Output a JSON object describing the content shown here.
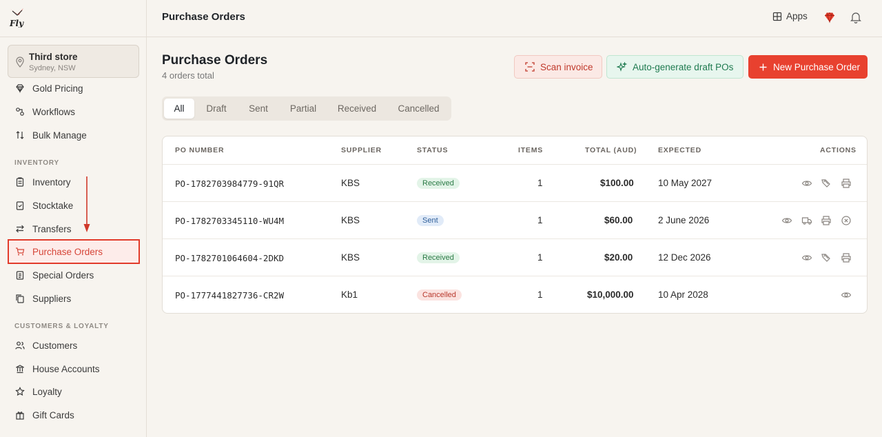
{
  "app": {
    "logo_text": "Fly"
  },
  "store": {
    "name": "Third store",
    "location": "Sydney, NSW"
  },
  "sidebar": {
    "items_top": [
      {
        "label": "Gold Pricing",
        "icon": "gem-icon"
      },
      {
        "label": "Workflows",
        "icon": "workflow-icon"
      },
      {
        "label": "Bulk Manage",
        "icon": "sort-arrows-icon"
      }
    ],
    "inventory_title": "INVENTORY",
    "inventory_items": [
      {
        "label": "Inventory",
        "icon": "clipboard-icon"
      },
      {
        "label": "Stocktake",
        "icon": "clipboard-check-icon"
      },
      {
        "label": "Transfers",
        "icon": "transfer-arrows-icon"
      },
      {
        "label": "Purchase Orders",
        "icon": "cart-icon",
        "active": true
      },
      {
        "label": "Special Orders",
        "icon": "clipboard-list-icon"
      },
      {
        "label": "Suppliers",
        "icon": "copy-icon"
      }
    ],
    "customers_title": "CUSTOMERS & LOYALTY",
    "customers_items": [
      {
        "label": "Customers",
        "icon": "users-icon"
      },
      {
        "label": "House Accounts",
        "icon": "bank-icon"
      },
      {
        "label": "Loyalty",
        "icon": "star-icon"
      },
      {
        "label": "Gift Cards",
        "icon": "gift-icon"
      }
    ]
  },
  "header": {
    "title": "Purchase Orders",
    "apps_label": "Apps"
  },
  "main": {
    "title": "Purchase Orders",
    "subtitle": "4 orders total",
    "buttons": {
      "scan": "Scan invoice",
      "auto": "Auto-generate draft POs",
      "new": "New Purchase Order"
    },
    "tabs": [
      "All",
      "Draft",
      "Sent",
      "Partial",
      "Received",
      "Cancelled"
    ],
    "active_tab": "All"
  },
  "table": {
    "columns": [
      "PO NUMBER",
      "SUPPLIER",
      "STATUS",
      "ITEMS",
      "TOTAL (AUD)",
      "EXPECTED",
      "ACTIONS"
    ],
    "rows": [
      {
        "po": "PO-1782703984779-91QR",
        "supplier": "KBS",
        "status": "Received",
        "items": "1",
        "total": "$100.00",
        "expected": "10 May 2027",
        "actions": [
          "view-icon",
          "tag-icon",
          "print-icon"
        ]
      },
      {
        "po": "PO-1782703345110-WU4M",
        "supplier": "KBS",
        "status": "Sent",
        "items": "1",
        "total": "$60.00",
        "expected": "2 June 2026",
        "actions": [
          "view-icon",
          "truck-icon",
          "print-icon",
          "cancel-icon"
        ]
      },
      {
        "po": "PO-1782701064604-2DKD",
        "supplier": "KBS",
        "status": "Received",
        "items": "1",
        "total": "$20.00",
        "expected": "12 Dec 2026",
        "actions": [
          "view-icon",
          "tag-icon",
          "print-icon"
        ]
      },
      {
        "po": "PO-1777441827736-CR2W",
        "supplier": "Kb1",
        "status": "Cancelled",
        "items": "1",
        "total": "$10,000.00",
        "expected": "10 Apr 2028",
        "actions": [
          "view-icon"
        ]
      }
    ]
  },
  "colors": {
    "accent": "#e8412f",
    "received": "#2a7a45",
    "sent": "#2f5f9a",
    "cancelled": "#b8382b"
  }
}
